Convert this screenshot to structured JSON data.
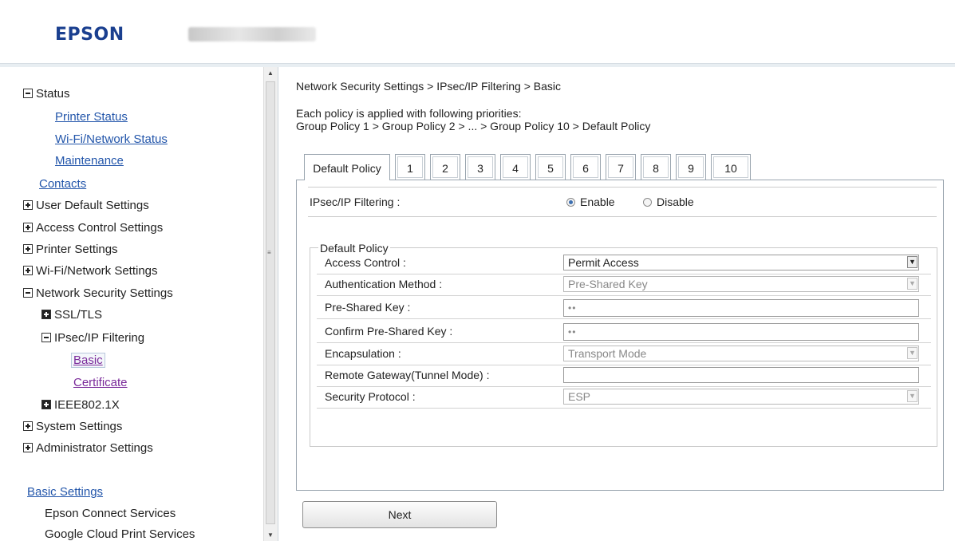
{
  "header": {
    "logo": "EPSON"
  },
  "sidebar": {
    "status": "Status",
    "printer_status": "Printer Status",
    "wifi_network_status": "Wi-Fi/Network Status",
    "maintenance": "Maintenance",
    "contacts": "Contacts",
    "user_default_settings": "User Default Settings",
    "access_control_settings": "Access Control Settings",
    "printer_settings": "Printer Settings",
    "wifi_network_settings": "Wi-Fi/Network Settings",
    "network_security_settings": "Network Security Settings",
    "ssl_tls": "SSL/TLS",
    "ipsec_ip_filtering": "IPsec/IP Filtering",
    "basic": "Basic",
    "certificate": "Certificate",
    "ieee8021x": "IEEE802.1X",
    "system_settings": "System Settings",
    "administrator_settings": "Administrator Settings",
    "basic_settings": "Basic Settings",
    "epson_connect_services": "Epson Connect Services",
    "google_cloud_print_services": "Google Cloud Print Services"
  },
  "content": {
    "breadcrumb": "Network Security Settings > IPsec/IP Filtering > Basic",
    "intro_line1": "Each policy is applied with following priorities:",
    "intro_line2": "Group Policy 1 > Group Policy 2 > ... > Group Policy 10 > Default Policy",
    "tabs": [
      "Default Policy",
      "1",
      "2",
      "3",
      "4",
      "5",
      "6",
      "7",
      "8",
      "9",
      "10"
    ],
    "active_tab": "Default Policy",
    "filter_label": "IPsec/IP Filtering :",
    "enable_label": "Enable",
    "disable_label": "Disable",
    "filter_value": "Enable",
    "legend": "Default Policy",
    "fields": {
      "access_control": {
        "label": "Access Control :",
        "value": "Permit Access"
      },
      "auth_method": {
        "label": "Authentication Method :",
        "value": "Pre-Shared Key"
      },
      "psk": {
        "label": "Pre-Shared Key :",
        "value": "••"
      },
      "confirm_psk": {
        "label": "Confirm Pre-Shared Key :",
        "value": "••"
      },
      "encapsulation": {
        "label": "Encapsulation :",
        "value": "Transport Mode"
      },
      "remote_gateway": {
        "label": "Remote Gateway(Tunnel Mode) :",
        "value": ""
      },
      "security_protocol": {
        "label": "Security Protocol :",
        "value": "ESP"
      }
    },
    "next_label": "Next"
  },
  "colors": {
    "brand": "#1a3f8f",
    "link": "#2255aa",
    "visited_link": "#7a2a9a"
  }
}
